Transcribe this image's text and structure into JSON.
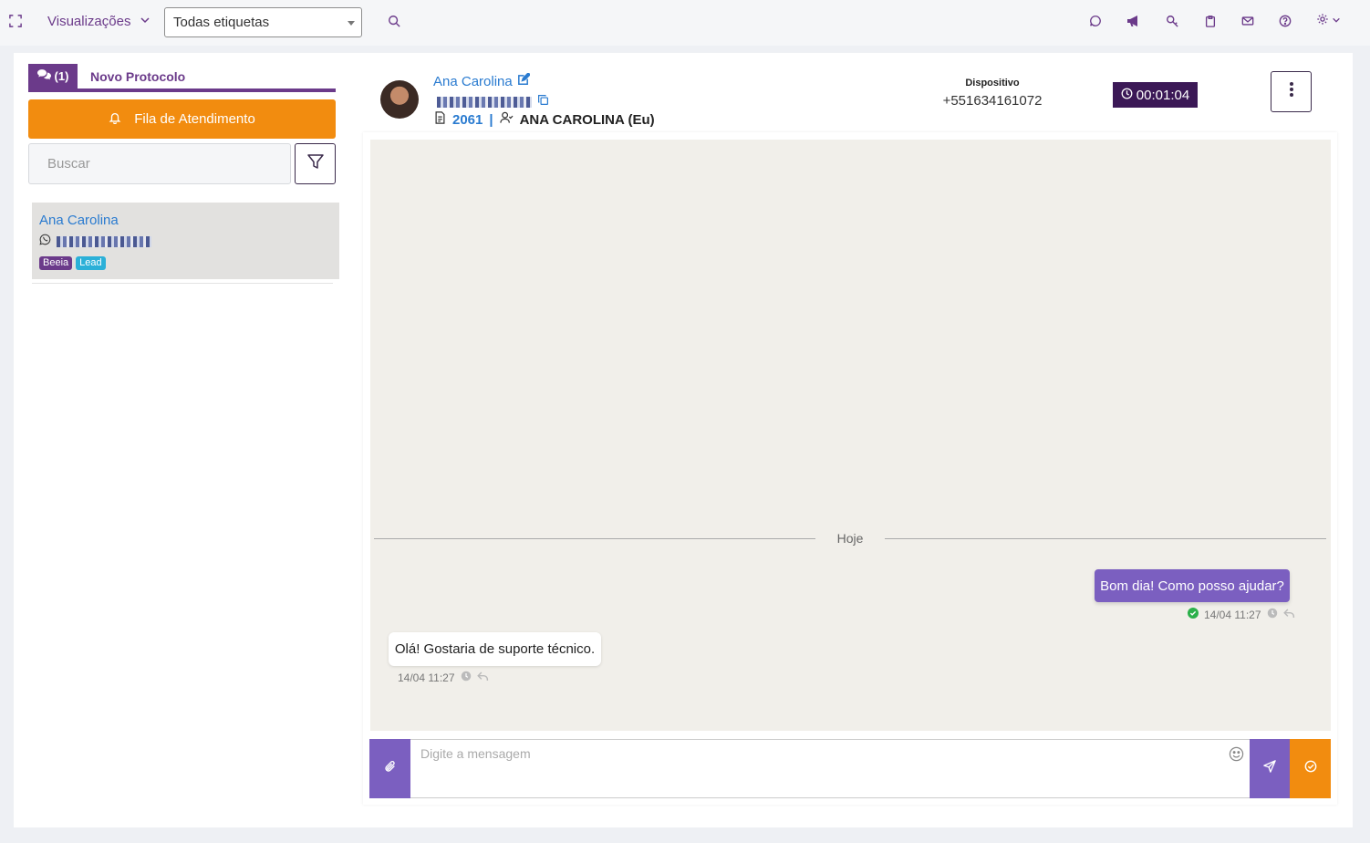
{
  "topbar": {
    "views_label": "Visualizações",
    "tag_select_value": "Todas etiquetas"
  },
  "left": {
    "tab_count": "(1)",
    "tab_new_protocol": "Novo Protocolo",
    "queue_button": "Fila de Atendimento",
    "search_placeholder": "Buscar",
    "contacts": [
      {
        "name": "Ana Carolina",
        "tags": [
          {
            "label": "Beeia",
            "color": "#6b3a8a"
          },
          {
            "label": "Lead",
            "color": "#2bb0d8"
          }
        ]
      }
    ]
  },
  "header": {
    "name": "Ana Carolina",
    "protocol": "2061",
    "separator": "|",
    "agent": "ANA CAROLINA (Eu)",
    "device_label": "Dispositivo",
    "device_number": "+551634161072",
    "timer": "00:01:04"
  },
  "chat": {
    "day_separator": "Hoje",
    "messages": [
      {
        "direction": "out",
        "text": "Bom dia! Como posso ajudar?",
        "time": "14/04 11:27"
      },
      {
        "direction": "in",
        "text": "Olá! Gostaria de suporte técnico.",
        "time": "14/04 11:27"
      }
    ],
    "input_placeholder": "Digite a mensagem"
  },
  "colors": {
    "primary": "#6b3a8a",
    "accent": "#f28c0f",
    "bubble_out": "#7b5fc0",
    "link": "#2a7bd0"
  }
}
